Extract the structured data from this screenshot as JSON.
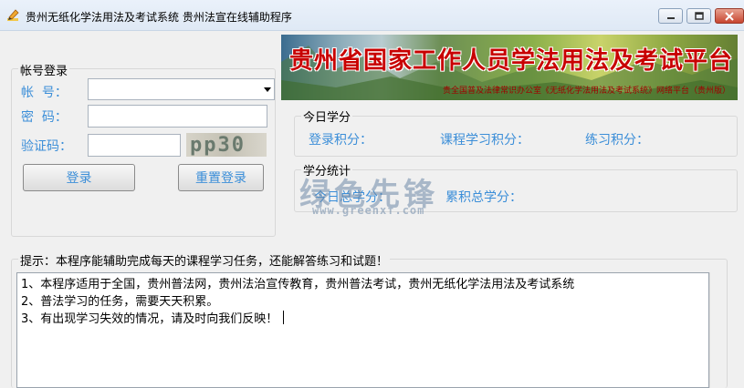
{
  "window": {
    "title": "贵州无纸化学法用法及考试系统 贵州法宣在线辅助程序",
    "app_icon": "pencil-icon",
    "controls": {
      "minimize": "minimize-icon",
      "maximize": "maximize-icon",
      "close": "close-icon"
    }
  },
  "login": {
    "group_label": "帐号登录",
    "account_label": "帐  号：",
    "account_value": "",
    "password_label": "密  码：",
    "password_value": "",
    "captcha_label": "验证码：",
    "captcha_value": "",
    "captcha_image_text": "pp30",
    "login_button": "登录",
    "reset_button": "重置登录"
  },
  "banner": {
    "title": "贵州省国家工作人员学法用法及考试平台",
    "subtitle": "贵全国普及法律常识办公室《无纸化学法用法及考试系统》网络平台（贵州版）"
  },
  "today": {
    "group_label": "今日学分",
    "login_points_label": "登录积分：",
    "course_points_label": "课程学习积分：",
    "practice_points_label": "练习积分："
  },
  "stats": {
    "group_label": "学分统计",
    "today_total_label": "今日总学分：",
    "cumulative_total_label": "累积总学分："
  },
  "watermark": {
    "text": "绿色先锋",
    "url": "www.greenxf.com"
  },
  "tips": {
    "group_label": "提示：本程序能辅助完成每天的课程学习任务，还能解答练习和试题！",
    "lines": [
      "1、本程序适用于全国，贵州普法网，贵州法治宣传教育，贵州普法考试，贵州无纸化学法用法及考试系统",
      "2、普法学习的任务，需要天天积累。",
      "3、有出现学习失效的情况，请及时向我们反映！"
    ]
  },
  "colors": {
    "label_blue": "#3b8ed8",
    "banner_red": "#c80000"
  }
}
